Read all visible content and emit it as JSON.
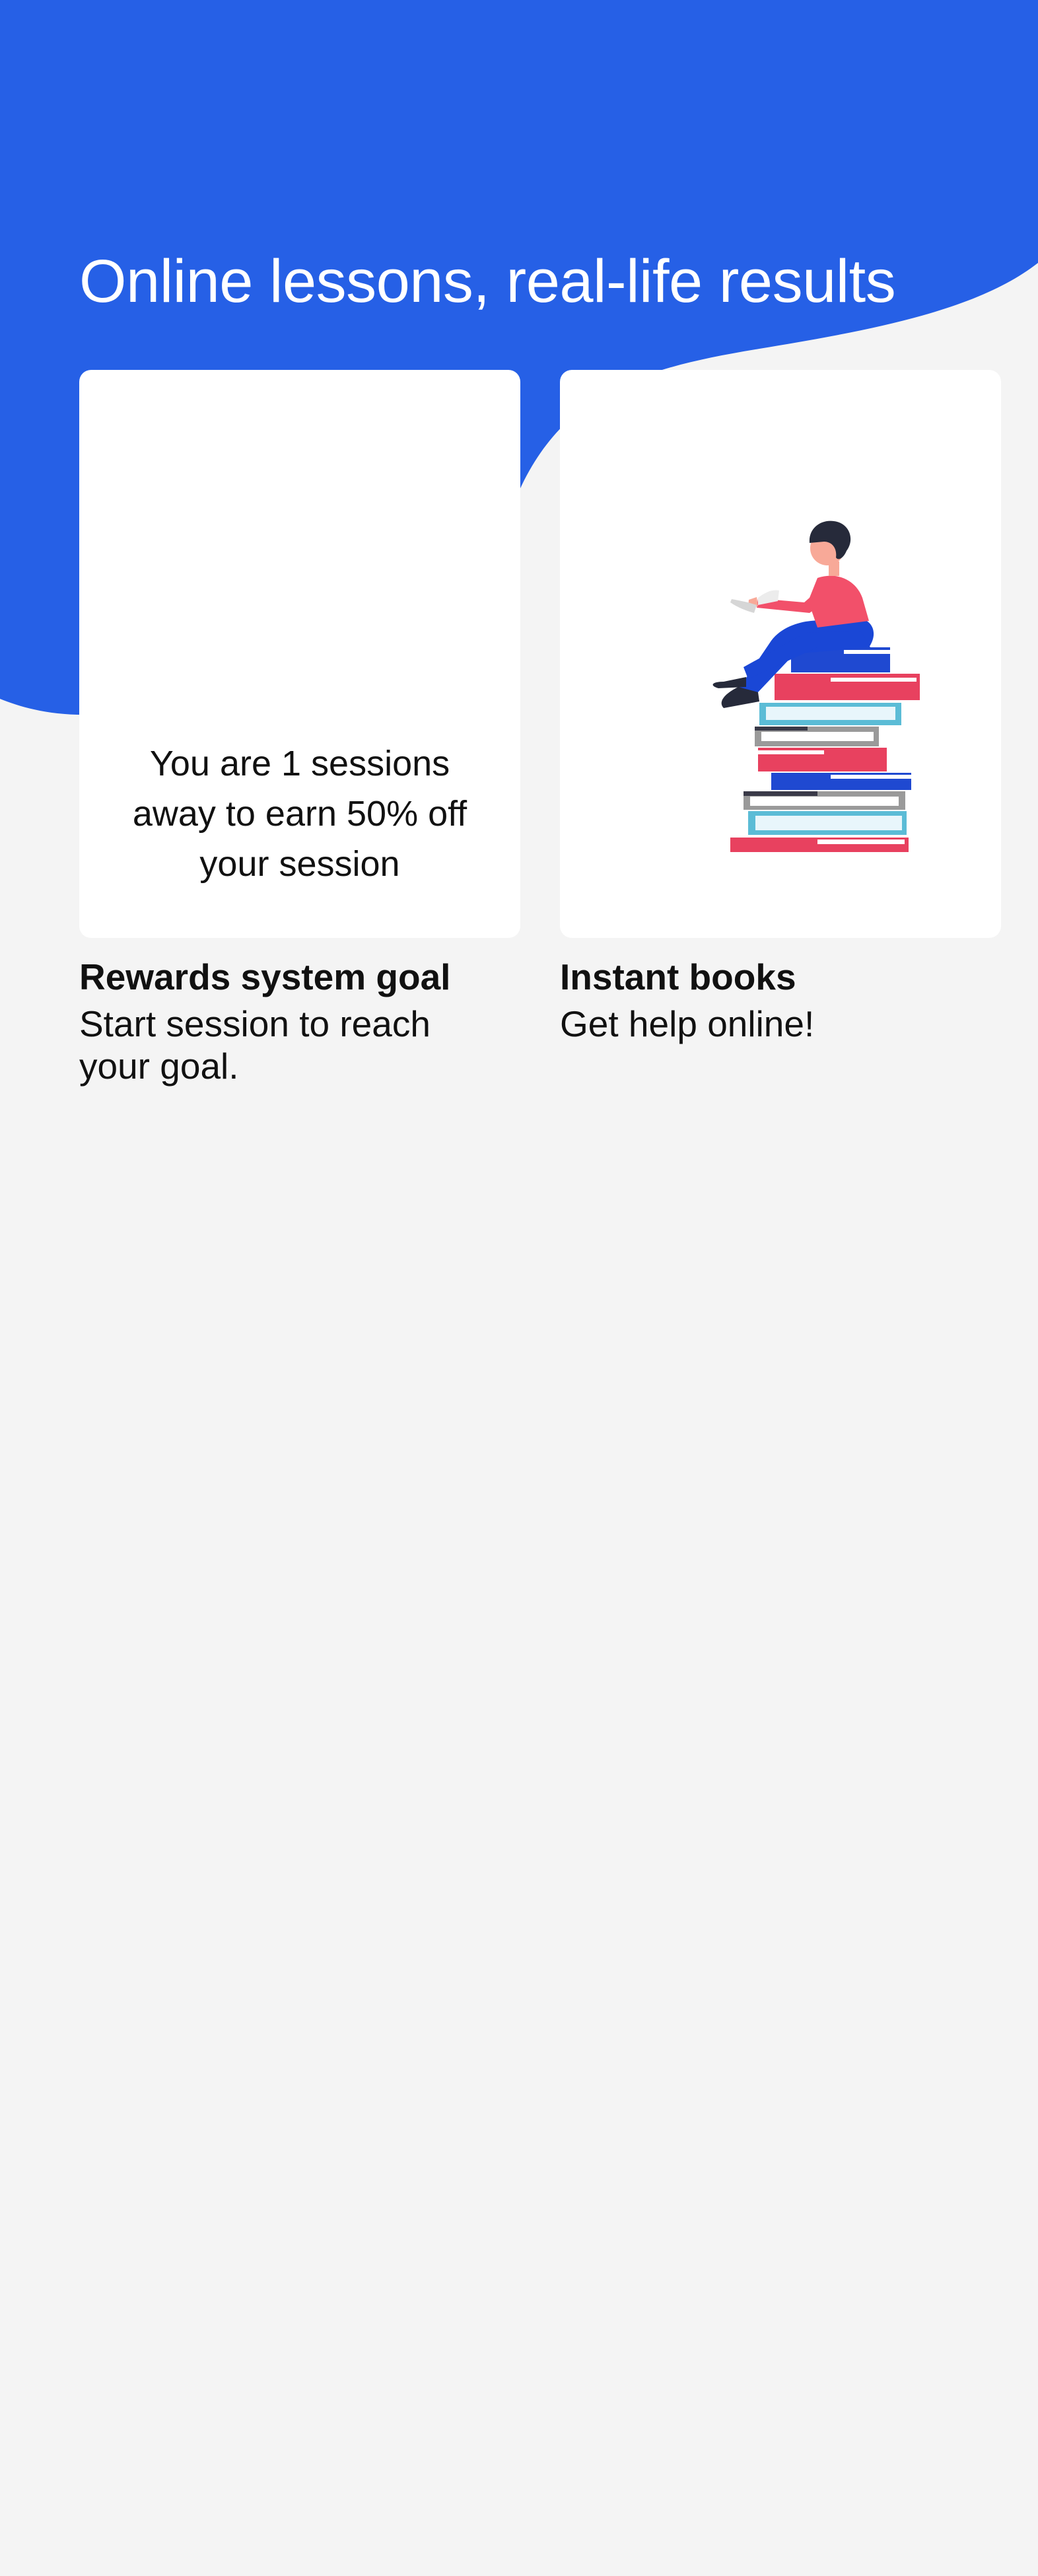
{
  "header": {
    "title": "Online lessons, real-life results"
  },
  "colors": {
    "brand_blue": "#2660e6",
    "page_background": "#f4f4f4",
    "card_background": "#ffffff",
    "accent_pink": "#f2506a"
  },
  "cards": [
    {
      "id": "rewards",
      "body_text": "You are 1 sessions away to earn 50% off your session",
      "title": "Rewards system goal",
      "description": "Start session to reach your goal."
    },
    {
      "id": "instant-books",
      "illustration": "person-reading-on-books-illustration",
      "title": "Instant books",
      "description": "Get help online!"
    }
  ]
}
